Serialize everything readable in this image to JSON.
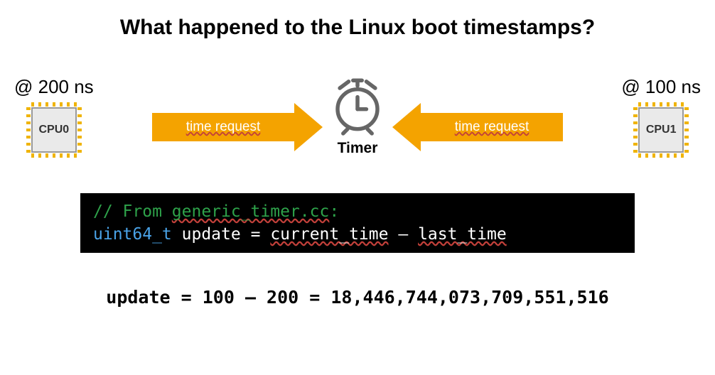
{
  "title": "What happened to the Linux boot timestamps?",
  "left": {
    "at": "@ 200 ns",
    "cpu": "CPU0",
    "arrow_text": "time request"
  },
  "right": {
    "at": "@ 100 ns",
    "cpu": "CPU1",
    "arrow_text": "time request"
  },
  "timer_label": "Timer",
  "code": {
    "comment": "// From generic_timer.cc:",
    "comment_word": "generic_timer.cc",
    "type": "uint64_t",
    "var": "update",
    "eq": "=",
    "expr1": "current_time",
    "minus": "–",
    "expr2": "last_time"
  },
  "equation": "update = 100 – 200 = 18,446,744,073,709,551,516"
}
